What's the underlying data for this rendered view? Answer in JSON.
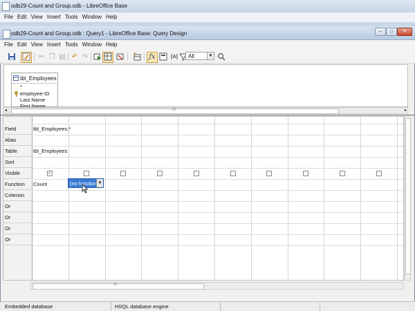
{
  "outer_window": {
    "title": "odb29-Count and Group.odb - LibreOffice Base",
    "menu": [
      "File",
      "Edit",
      "View",
      "Insert",
      "Tools",
      "Window",
      "Help"
    ]
  },
  "inner_window": {
    "title": "odb29-Count and Group.odb : Query1 - LibreOffice Base: Query Design",
    "menu": [
      "File",
      "Edit",
      "View",
      "Insert",
      "Tools",
      "Window",
      "Help"
    ],
    "window_buttons": [
      "–",
      "□",
      "✕"
    ]
  },
  "toolbar": {
    "limit_value": "All"
  },
  "table_window": {
    "name": "tbl_Employees",
    "fields": [
      "*",
      "employee-ID",
      "Last Name",
      "First Name"
    ]
  },
  "grid": {
    "row_headers": [
      "Field",
      "Alias",
      "Table",
      "Sort",
      "Visible",
      "Function",
      "Criterion",
      "Or",
      "Or",
      "Or",
      "Or"
    ],
    "column1": {
      "field": "tbl_Employees.*",
      "table": "tbl_Employees",
      "function": "Count"
    },
    "column2": {
      "function": "(no function)"
    }
  },
  "statusbar": {
    "left": "Embedded database",
    "middle": "HSQL database engine"
  },
  "colors": {
    "selection": "#3b7bd3",
    "active_tool": "#fbe7b6"
  }
}
